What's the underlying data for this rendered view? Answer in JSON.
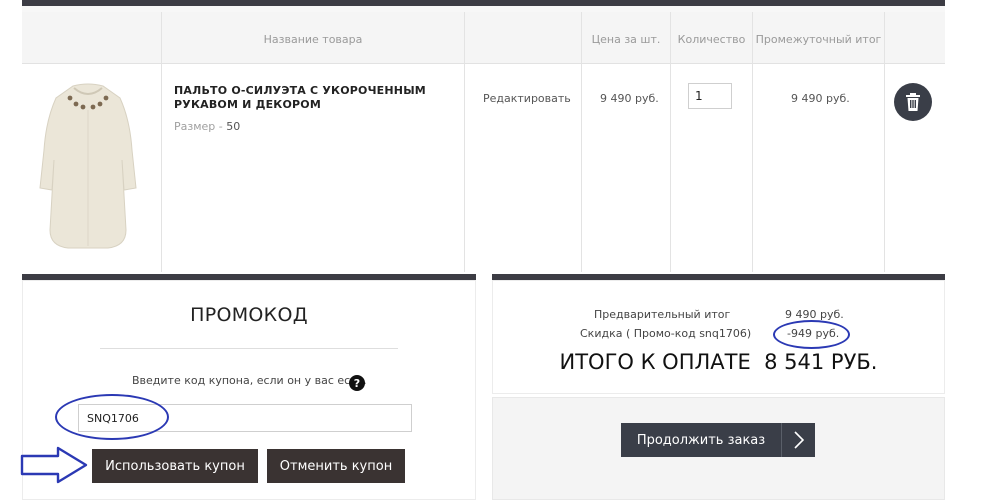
{
  "cart": {
    "headers": {
      "name": "Название товара",
      "price": "Цена за шт.",
      "qty": "Количество",
      "subtotal": "Промежуточный итог"
    },
    "item": {
      "name": "ПАЛЬТО О-СИЛУЭТА С УКОРОЧЕННЫМ РУКАВОМ И ДЕКОРОМ",
      "size_label": "Размер",
      "size_sep": " - ",
      "size_value": "50",
      "edit_label": "Редактировать",
      "price": "9 490 руб.",
      "quantity": "1",
      "subtotal": "9 490 руб.",
      "image_icon": "coat-product-image",
      "delete_icon": "trash-icon"
    }
  },
  "promo": {
    "title": "ПРОМОКОД",
    "hint": "Введите код купона, если он у вас есть.",
    "help_icon": "?",
    "code_value": "SNQ1706",
    "apply_label": "Использовать купон",
    "cancel_label": "Отменить купон"
  },
  "totals": {
    "subtotal_label": "Предварительный итог",
    "subtotal_value": "9 490 руб.",
    "discount_label": "Скидка ( Промо-код snq1706)",
    "discount_value": "-949 руб.",
    "grand_label": "ИТОГО К ОПЛАТЕ",
    "grand_value": "8 541 РУБ.",
    "continue_label": "Продолжить заказ",
    "continue_icon": "chevron-right-icon"
  },
  "colors": {
    "dark_bar": "#3c3c44",
    "button_dark": "#3a3332",
    "button_slate": "#3a3e48",
    "annotation_blue": "#2b39b4"
  }
}
